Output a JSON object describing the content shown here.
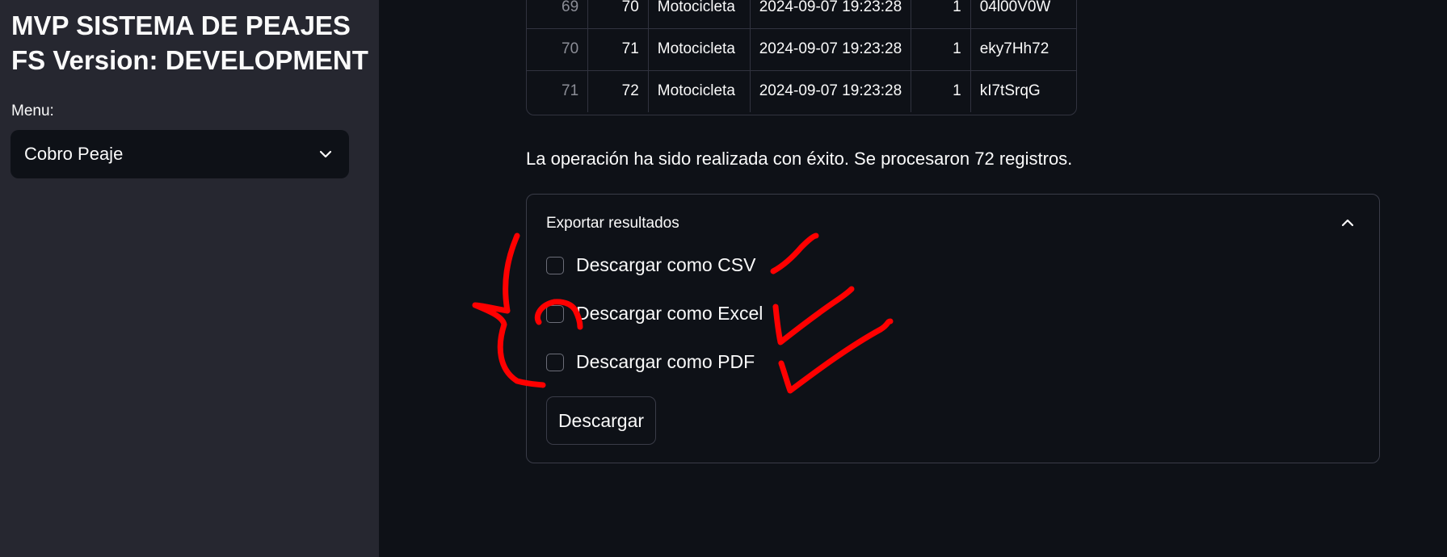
{
  "sidebar": {
    "title_line1": "MVP SISTEMA DE PEAJES",
    "title_line2": "FS Version: DEVELOPMENT",
    "menu_label": "Menu:",
    "menu_value": "Cobro Peaje",
    "menu_icon": "chevron-down-icon"
  },
  "table": {
    "rows": [
      {
        "index": "69",
        "id": "70",
        "type": "Motocicleta",
        "datetime": "2024-09-07 19:23:28",
        "count": "1",
        "code": "04l00V0W"
      },
      {
        "index": "70",
        "id": "71",
        "type": "Motocicleta",
        "datetime": "2024-09-07 19:23:28",
        "count": "1",
        "code": "eky7Hh72"
      },
      {
        "index": "71",
        "id": "72",
        "type": "Motocicleta",
        "datetime": "2024-09-07 19:23:28",
        "count": "1",
        "code": "kI7tSrqG"
      }
    ]
  },
  "message": {
    "success": "La operación ha sido realizada con éxito. Se procesaron 72 registros."
  },
  "export": {
    "header": "Exportar resultados",
    "header_icon": "chevron-up-icon",
    "options": [
      {
        "label": "Descargar como CSV",
        "checked": false
      },
      {
        "label": "Descargar como Excel",
        "checked": false
      },
      {
        "label": "Descargar como PDF",
        "checked": false
      }
    ],
    "button_label": "Descargar"
  },
  "colors": {
    "background": "#0e1117",
    "sidebar": "#262730",
    "border": "#31333f",
    "annotation": "#ff0000"
  }
}
